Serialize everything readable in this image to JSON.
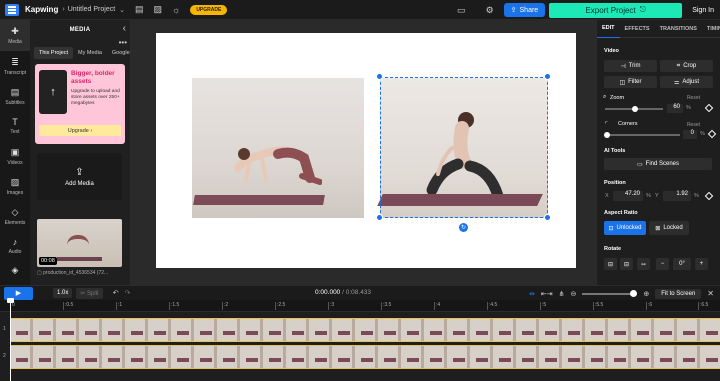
{
  "topbar": {
    "brand": "Kapwing",
    "crumb_sep": "›",
    "project_name": "Untitled Project",
    "project_chevron": "⌄",
    "upgrade_label": "UPGRADE",
    "share_label": "Share",
    "export_label": "Export Project",
    "signin_label": "Sign In"
  },
  "leftnav": [
    {
      "label": "Media",
      "icon": "✚"
    },
    {
      "label": "Transcript",
      "icon": "≣"
    },
    {
      "label": "Subtitles",
      "icon": "▤"
    },
    {
      "label": "Text",
      "icon": "T"
    },
    {
      "label": "Videos",
      "icon": "▣"
    },
    {
      "label": "Images",
      "icon": "▨"
    },
    {
      "label": "Elements",
      "icon": "◇"
    },
    {
      "label": "Audio",
      "icon": "♪"
    },
    {
      "label": "",
      "icon": "◈"
    }
  ],
  "media": {
    "title": "MEDIA",
    "collapse": "‹",
    "more": "•••",
    "tabs": [
      "This Project",
      "My Media",
      "Google"
    ],
    "promo": {
      "icon": "↑",
      "heading": "Bigger, bolder assets",
      "body": "Upgrade to upload and store assets over 250+ megabytes",
      "button": "Upgrade ›"
    },
    "add_media_label": "Add Media",
    "add_media_icon": "⇪",
    "clip": {
      "duration": "00:08",
      "name": "production_id_4536534 (72..."
    }
  },
  "props": {
    "tabs": [
      "EDIT",
      "EFFECTS",
      "TRANSITIONS",
      "TIMING"
    ],
    "video_label": "Video",
    "trim": "Trim",
    "crop": "Crop",
    "filter": "Filter",
    "adjust": "Adjust",
    "zoom_label": "Zoom",
    "zoom_value": "60",
    "reset": "Reset",
    "corners_label": "Corners",
    "corners_value": "0",
    "percent": "%",
    "ai_tools_label": "AI Tools",
    "find_scenes": "Find Scenes",
    "position_label": "Position",
    "x_label": "X",
    "x_value": "47.20",
    "y_label": "Y",
    "y_value": "1.92",
    "aspect_label": "Aspect Ratio",
    "unlocked": "Unlocked",
    "locked": "Locked",
    "rotate_label": "Rotate"
  },
  "timeline": {
    "play_icon": "▶",
    "speed": "1.0x",
    "split": "✂ Split",
    "undo": "↶",
    "redo": "↷",
    "time_current": "0:00.000",
    "time_total": "/ 0:08.433",
    "fit_label": "Fit to Screen",
    "ticks": [
      "0",
      ":0.5",
      ":1",
      ":1.5",
      ":2",
      ":2.5",
      ":3",
      ":3.5",
      ":4",
      ":4.5",
      ":5",
      ":5.5",
      ":6",
      ":6.5"
    ],
    "tracks": [
      "1",
      "2"
    ]
  }
}
